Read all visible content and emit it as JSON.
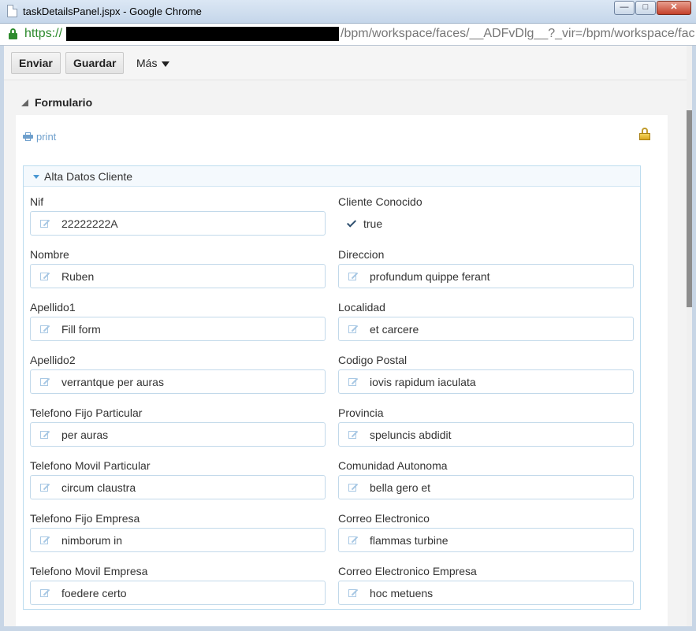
{
  "window": {
    "title": "taskDetailsPanel.jspx - Google Chrome",
    "minimize": "—",
    "maximize": "□",
    "close": "✕"
  },
  "address": {
    "scheme": "https://",
    "url": "/bpm/workspace/faces/__ADFvDlg__?_vir=/bpm/workspace/fac"
  },
  "toolbar": {
    "enviar": "Enviar",
    "guardar": "Guardar",
    "mas": "Más"
  },
  "section": {
    "title": "Formulario",
    "print": "print"
  },
  "panel": {
    "title": "Alta Datos Cliente",
    "left": [
      {
        "label": "Nif",
        "value": "22222222A"
      },
      {
        "label": "Nombre",
        "value": "Ruben"
      },
      {
        "label": "Apellido1",
        "value": "Fill form"
      },
      {
        "label": "Apellido2",
        "value": "verrantque per auras"
      },
      {
        "label": "Telefono Fijo Particular",
        "value": "per auras"
      },
      {
        "label": "Telefono Movil Particular",
        "value": "circum claustra"
      },
      {
        "label": "Telefono Fijo Empresa",
        "value": "nimborum in"
      },
      {
        "label": "Telefono Movil Empresa",
        "value": "foedere certo"
      }
    ],
    "right": [
      {
        "label": "Cliente Conocido",
        "value": "true"
      },
      {
        "label": "Direccion",
        "value": "profundum quippe ferant"
      },
      {
        "label": "Localidad",
        "value": "et carcere"
      },
      {
        "label": "Codigo Postal",
        "value": "iovis rapidum iaculata"
      },
      {
        "label": "Provincia",
        "value": "speluncis abdidit"
      },
      {
        "label": "Comunidad Autonoma",
        "value": "bella gero et"
      },
      {
        "label": "Correo Electronico",
        "value": "flammas turbine"
      },
      {
        "label": "Correo Electronico Empresa",
        "value": "hoc metuens"
      }
    ]
  }
}
